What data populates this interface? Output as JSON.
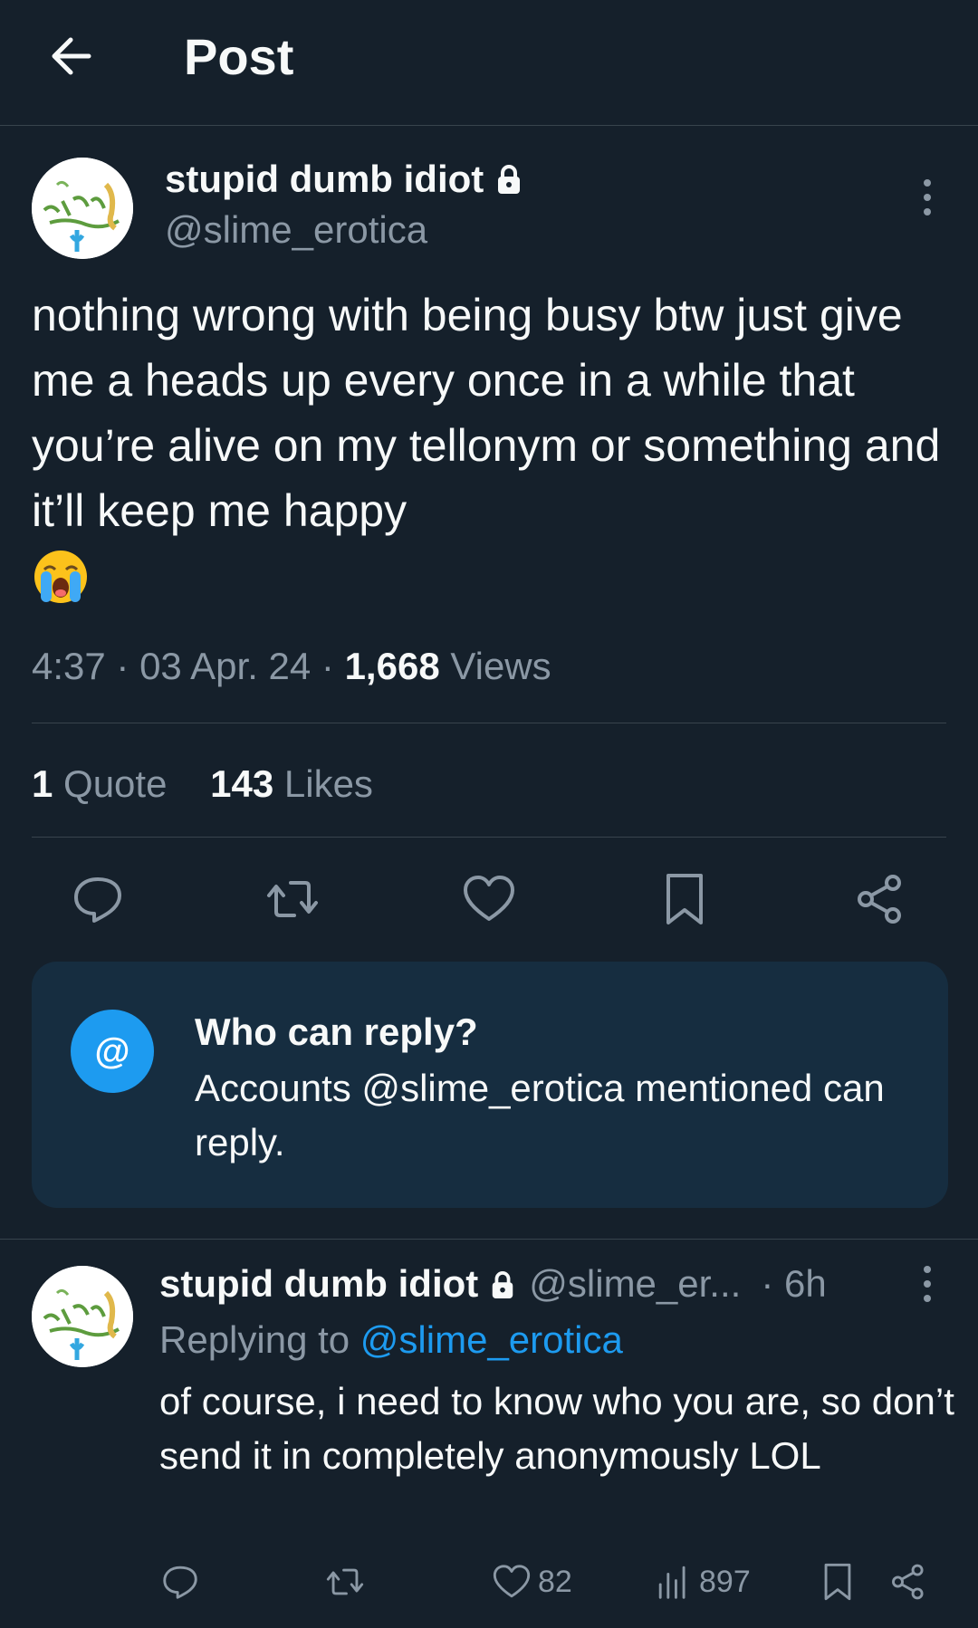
{
  "header": {
    "title": "Post"
  },
  "post": {
    "author": "stupid dumb idiot",
    "handle": "@slime_erotica",
    "text": "nothing wrong with being busy btw just give me a heads up every once in a while that you’re alive on my tellonym or something and it’ll keep me happy",
    "emoji": "loudly-crying-face",
    "time": "4:37",
    "date": "03 Apr. 24",
    "views_count": "1,668",
    "views_label": "Views",
    "quotes_count": "1",
    "quotes_label": "Quote",
    "likes_count": "143",
    "likes_label": "Likes"
  },
  "reply_restriction": {
    "icon": "@",
    "title": "Who can reply?",
    "body": "Accounts @slime_erotica mentioned can reply."
  },
  "reply": {
    "author": "stupid dumb idiot",
    "handle": "@slime_er...",
    "time": "· 6h",
    "replying_prefix": "Replying to",
    "replying_to": "@slime_erotica",
    "text": "of course, i need to know who you are, so don’t send it in completely anonymously LOL",
    "likes": "82",
    "views": "897"
  },
  "colors": {
    "background": "#15202b",
    "text": "#f7f9f9",
    "secondary": "#8b98a5",
    "accent": "#1d9bf0",
    "divider": "#38444d",
    "card": "#162d40"
  }
}
